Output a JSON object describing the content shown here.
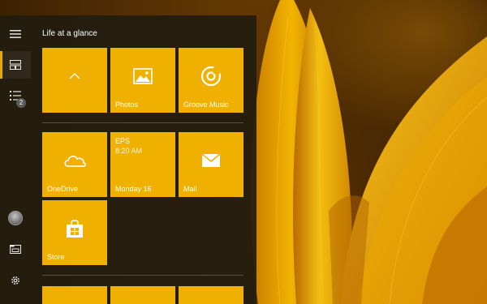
{
  "rail": {
    "items": [
      {
        "icon": "hamburger-menu-icon"
      },
      {
        "icon": "tiles-icon"
      },
      {
        "icon": "all-apps-list-icon",
        "badge": "2"
      },
      {
        "icon": "user-avatar-icon"
      },
      {
        "icon": "file-explorer-icon"
      },
      {
        "icon": "settings-gear-icon"
      }
    ]
  },
  "group": {
    "title": "Life at a glance"
  },
  "tiles": {
    "collapse": {
      "icon": "chevron-up-icon"
    },
    "photos": {
      "label": "Photos",
      "icon": "photos-icon"
    },
    "groove": {
      "label": "Groove Music",
      "icon": "groove-music-icon"
    },
    "onedrive": {
      "label": "OneDrive",
      "icon": "onedrive-cloud-icon"
    },
    "calendar": {
      "event": "EPS",
      "time": "8:20 AM",
      "label": "Monday 16"
    },
    "mail": {
      "label": "Mail",
      "icon": "mail-envelope-icon"
    },
    "store": {
      "label": "Store",
      "icon": "store-bag-icon"
    }
  },
  "colors": {
    "accent": "#f0b000",
    "menu_background": "#221c0e",
    "text": "#ffffff"
  }
}
